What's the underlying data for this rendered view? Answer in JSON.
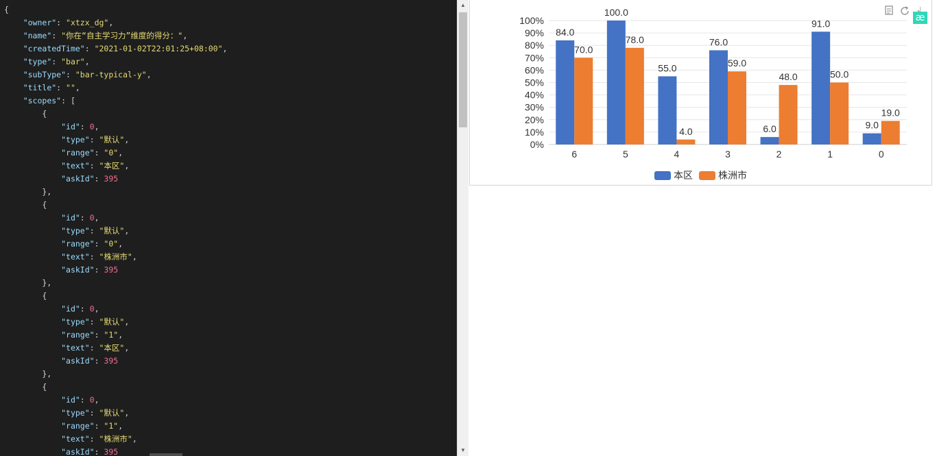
{
  "editor": {
    "lines": [
      [
        [
          "{",
          "p"
        ]
      ],
      [
        [
          "    ",
          "p"
        ],
        [
          "\"owner\"",
          "q"
        ],
        [
          ": ",
          "p"
        ],
        [
          "\"xtzx_dg\"",
          "s"
        ],
        [
          ",",
          "p"
        ]
      ],
      [
        [
          "    ",
          "p"
        ],
        [
          "\"name\"",
          "q"
        ],
        [
          ": ",
          "p"
        ],
        [
          "\"你在“自主学习力”维度的得分：\"",
          "s"
        ],
        [
          ",",
          "p"
        ]
      ],
      [
        [
          "    ",
          "p"
        ],
        [
          "\"createdTime\"",
          "q"
        ],
        [
          ": ",
          "p"
        ],
        [
          "\"2021-01-02T22:01:25+08:00\"",
          "s"
        ],
        [
          ",",
          "p"
        ]
      ],
      [
        [
          "    ",
          "p"
        ],
        [
          "\"type\"",
          "q"
        ],
        [
          ": ",
          "p"
        ],
        [
          "\"bar\"",
          "s"
        ],
        [
          ",",
          "p"
        ]
      ],
      [
        [
          "    ",
          "p"
        ],
        [
          "\"subType\"",
          "q"
        ],
        [
          ": ",
          "p"
        ],
        [
          "\"bar-typical-y\"",
          "s"
        ],
        [
          ",",
          "p"
        ]
      ],
      [
        [
          "    ",
          "p"
        ],
        [
          "\"title\"",
          "q"
        ],
        [
          ": ",
          "p"
        ],
        [
          "\"\"",
          "s"
        ],
        [
          ",",
          "p"
        ]
      ],
      [
        [
          "    ",
          "p"
        ],
        [
          "\"scopes\"",
          "q"
        ],
        [
          ": [",
          "p"
        ]
      ],
      [
        [
          "        {",
          "p"
        ]
      ],
      [
        [
          "            ",
          "p"
        ],
        [
          "\"id\"",
          "q"
        ],
        [
          ": ",
          "p"
        ],
        [
          "0",
          "n"
        ],
        [
          ",",
          "p"
        ]
      ],
      [
        [
          "            ",
          "p"
        ],
        [
          "\"type\"",
          "q"
        ],
        [
          ": ",
          "p"
        ],
        [
          "\"默认\"",
          "s"
        ],
        [
          ",",
          "p"
        ]
      ],
      [
        [
          "            ",
          "p"
        ],
        [
          "\"range\"",
          "q"
        ],
        [
          ": ",
          "p"
        ],
        [
          "\"0\"",
          "s"
        ],
        [
          ",",
          "p"
        ]
      ],
      [
        [
          "            ",
          "p"
        ],
        [
          "\"text\"",
          "q"
        ],
        [
          ": ",
          "p"
        ],
        [
          "\"本区\"",
          "s"
        ],
        [
          ",",
          "p"
        ]
      ],
      [
        [
          "            ",
          "p"
        ],
        [
          "\"askId\"",
          "q"
        ],
        [
          ": ",
          "p"
        ],
        [
          "395",
          "n"
        ]
      ],
      [
        [
          "        },",
          "p"
        ]
      ],
      [
        [
          "        {",
          "p"
        ]
      ],
      [
        [
          "            ",
          "p"
        ],
        [
          "\"id\"",
          "q"
        ],
        [
          ": ",
          "p"
        ],
        [
          "0",
          "n"
        ],
        [
          ",",
          "p"
        ]
      ],
      [
        [
          "            ",
          "p"
        ],
        [
          "\"type\"",
          "q"
        ],
        [
          ": ",
          "p"
        ],
        [
          "\"默认\"",
          "s"
        ],
        [
          ",",
          "p"
        ]
      ],
      [
        [
          "            ",
          "p"
        ],
        [
          "\"range\"",
          "q"
        ],
        [
          ": ",
          "p"
        ],
        [
          "\"0\"",
          "s"
        ],
        [
          ",",
          "p"
        ]
      ],
      [
        [
          "            ",
          "p"
        ],
        [
          "\"text\"",
          "q"
        ],
        [
          ": ",
          "p"
        ],
        [
          "\"株洲市\"",
          "s"
        ],
        [
          ",",
          "p"
        ]
      ],
      [
        [
          "            ",
          "p"
        ],
        [
          "\"askId\"",
          "q"
        ],
        [
          ": ",
          "p"
        ],
        [
          "395",
          "n"
        ]
      ],
      [
        [
          "        },",
          "p"
        ]
      ],
      [
        [
          "        {",
          "p"
        ]
      ],
      [
        [
          "            ",
          "p"
        ],
        [
          "\"id\"",
          "q"
        ],
        [
          ": ",
          "p"
        ],
        [
          "0",
          "n"
        ],
        [
          ",",
          "p"
        ]
      ],
      [
        [
          "            ",
          "p"
        ],
        [
          "\"type\"",
          "q"
        ],
        [
          ": ",
          "p"
        ],
        [
          "\"默认\"",
          "s"
        ],
        [
          ",",
          "p"
        ]
      ],
      [
        [
          "            ",
          "p"
        ],
        [
          "\"range\"",
          "q"
        ],
        [
          ": ",
          "p"
        ],
        [
          "\"1\"",
          "s"
        ],
        [
          ",",
          "p"
        ]
      ],
      [
        [
          "            ",
          "p"
        ],
        [
          "\"text\"",
          "q"
        ],
        [
          ": ",
          "p"
        ],
        [
          "\"本区\"",
          "s"
        ],
        [
          ",",
          "p"
        ]
      ],
      [
        [
          "            ",
          "p"
        ],
        [
          "\"askId\"",
          "q"
        ],
        [
          ": ",
          "p"
        ],
        [
          "395",
          "n"
        ]
      ],
      [
        [
          "        },",
          "p"
        ]
      ],
      [
        [
          "        {",
          "p"
        ]
      ],
      [
        [
          "            ",
          "p"
        ],
        [
          "\"id\"",
          "q"
        ],
        [
          ": ",
          "p"
        ],
        [
          "0",
          "n"
        ],
        [
          ",",
          "p"
        ]
      ],
      [
        [
          "            ",
          "p"
        ],
        [
          "\"type\"",
          "q"
        ],
        [
          ": ",
          "p"
        ],
        [
          "\"默认\"",
          "s"
        ],
        [
          ",",
          "p"
        ]
      ],
      [
        [
          "            ",
          "p"
        ],
        [
          "\"range\"",
          "q"
        ],
        [
          ": ",
          "p"
        ],
        [
          "\"1\"",
          "s"
        ],
        [
          ",",
          "p"
        ]
      ],
      [
        [
          "            ",
          "p"
        ],
        [
          "\"text\"",
          "q"
        ],
        [
          ": ",
          "p"
        ],
        [
          "\"株洲市\"",
          "s"
        ],
        [
          ",",
          "p"
        ]
      ],
      [
        [
          "            ",
          "p"
        ],
        [
          "\"askId\"",
          "q"
        ],
        [
          ": ",
          "p"
        ],
        [
          "395",
          "n"
        ]
      ]
    ]
  },
  "toolbox": {
    "icons": [
      "data-view-icon",
      "restore-icon",
      "save-image-icon"
    ],
    "badge_label": "æ"
  },
  "colors": {
    "series1": "#4472c4",
    "series2": "#ed7d31",
    "badge": "#2fd7b7"
  },
  "chart_data": {
    "type": "bar",
    "categories": [
      "6",
      "5",
      "4",
      "3",
      "2",
      "1",
      "0"
    ],
    "series": [
      {
        "name": "本区",
        "values": [
          84.0,
          100.0,
          55.0,
          76.0,
          6.0,
          91.0,
          9.0
        ]
      },
      {
        "name": "株洲市",
        "values": [
          70.0,
          78.0,
          4.0,
          59.0,
          48.0,
          50.0,
          19.0
        ]
      }
    ],
    "value_labels_format": "one-decimal",
    "y_ticks": [
      "0%",
      "10%",
      "20%",
      "30%",
      "40%",
      "50%",
      "60%",
      "70%",
      "80%",
      "90%",
      "100%"
    ],
    "ylim": [
      0,
      100
    ],
    "grid": true,
    "legend": "bottom-center",
    "title": "",
    "xlabel": "",
    "ylabel": ""
  }
}
